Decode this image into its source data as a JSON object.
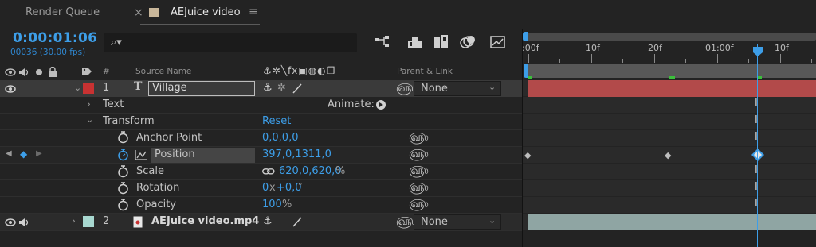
{
  "tabs": {
    "render_queue": "Render Queue",
    "close_glyph": "×",
    "active_comp": "AEJuice video",
    "menu_glyph": "≡"
  },
  "timecode": {
    "current": "0:00:01:06",
    "frames": "00036 (30.00 fps)"
  },
  "search": {
    "placeholder": "",
    "glyph": "⌕▾"
  },
  "column_headers": {
    "number": "#",
    "source_name": "Source Name",
    "switches": "⚓✲╲fx▣◍◐❒",
    "parent_link": "Parent & Link"
  },
  "layers": [
    {
      "index": "1",
      "type_glyph": "T",
      "name": "Village",
      "label_color": "#c83232",
      "parent": "None"
    },
    {
      "index": "2",
      "type_glyph": "▣",
      "name": "AEJuice video.mp4",
      "label_color": "#a8d8d0",
      "parent": "None"
    }
  ],
  "properties": {
    "text_group": "Text",
    "animate_label": "Animate:",
    "transform_group": "Transform",
    "reset_label": "Reset",
    "anchor_point": {
      "label": "Anchor Point",
      "value": "0,0,0,0"
    },
    "position": {
      "label": "Position",
      "value": "397,0,1311,0"
    },
    "scale": {
      "label": "Scale",
      "value": "620,0,620,0",
      "unit": "%"
    },
    "rotation": {
      "label": "Rotation",
      "value_a": "0",
      "x_label": "x",
      "value_b": "+0,0",
      "unit": "°"
    },
    "opacity": {
      "label": "Opacity",
      "value": "100",
      "unit": "%"
    }
  },
  "ruler": {
    "labels": [
      ":00f",
      "10f",
      "20f",
      "01:00f",
      "10f"
    ]
  },
  "colors": {
    "accent_blue": "#3d9ee8",
    "layer1_bar": "#b24a4a",
    "layer2_bar": "#8fa5a3",
    "background": "#232323"
  }
}
